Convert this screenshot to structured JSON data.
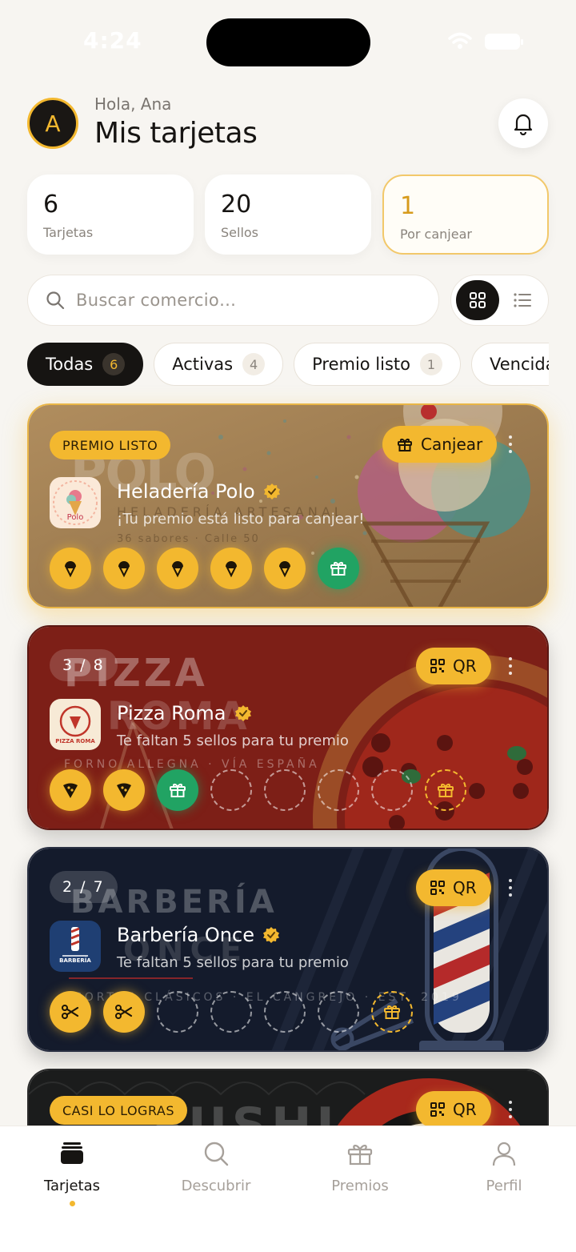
{
  "status": {
    "time": "4:24"
  },
  "header": {
    "avatar_initial": "A",
    "greeting": "Hola, Ana",
    "title": "Mis tarjetas"
  },
  "stats": [
    {
      "value": "6",
      "label": "Tarjetas"
    },
    {
      "value": "20",
      "label": "Sellos"
    },
    {
      "value": "1",
      "label": "Por canjear"
    }
  ],
  "search": {
    "placeholder": "Buscar comercio…"
  },
  "filters": [
    {
      "label": "Todas",
      "count": "6"
    },
    {
      "label": "Activas",
      "count": "4"
    },
    {
      "label": "Premio listo",
      "count": "1"
    },
    {
      "label": "Vencidas",
      "count": ""
    }
  ],
  "cards": [
    {
      "badge": "PREMIO LISTO",
      "action": "Canjear",
      "name": "Heladería Polo",
      "message": "¡Tu premio está listo para canjear!",
      "watermark": "POLO",
      "tagline": "HELADERÍA ARTESANAL",
      "tagline2": "36 sabores · Calle 50",
      "logo_text": "Polo",
      "stamps_filled": 5,
      "stamps_total": 6,
      "theme": "#9b7a4f",
      "stamp_icon": "ice-cream-icon"
    },
    {
      "badge": "3 / 8",
      "action": "QR",
      "name": "Pizza Roma",
      "message": "Te faltan 5 sellos para tu premio",
      "watermark": "PIZZA",
      "watermark2": "ROMA",
      "tagline": "FORNO ALLEGNA · VÍA ESPAÑA",
      "logo_text": "PIZZA ROMA",
      "stamps_filled": 3,
      "stamps_total": 8,
      "theme": "#7a1e18",
      "stamp_icon": "pizza-icon"
    },
    {
      "badge": "2 / 7",
      "action": "QR",
      "name": "Barbería Once",
      "message": "Te faltan 5 sellos para tu premio",
      "watermark": "BARBERÍA",
      "watermark2": "ONCE",
      "tagline": "CORTES CLÁSICOS · EL CANGREJO · EST. 2019",
      "logo_text": "BARBERÍA",
      "stamps_filled": 2,
      "stamps_total": 7,
      "theme": "#141b2c",
      "stamp_icon": "scissors-icon"
    },
    {
      "badge": "CASI LO LOGRAS",
      "action": "QR",
      "watermark": "SUSHI",
      "theme": "#1a1a1a"
    }
  ],
  "tabs": [
    {
      "label": "Tarjetas"
    },
    {
      "label": "Descubrir"
    },
    {
      "label": "Premios"
    },
    {
      "label": "Perfil"
    }
  ]
}
